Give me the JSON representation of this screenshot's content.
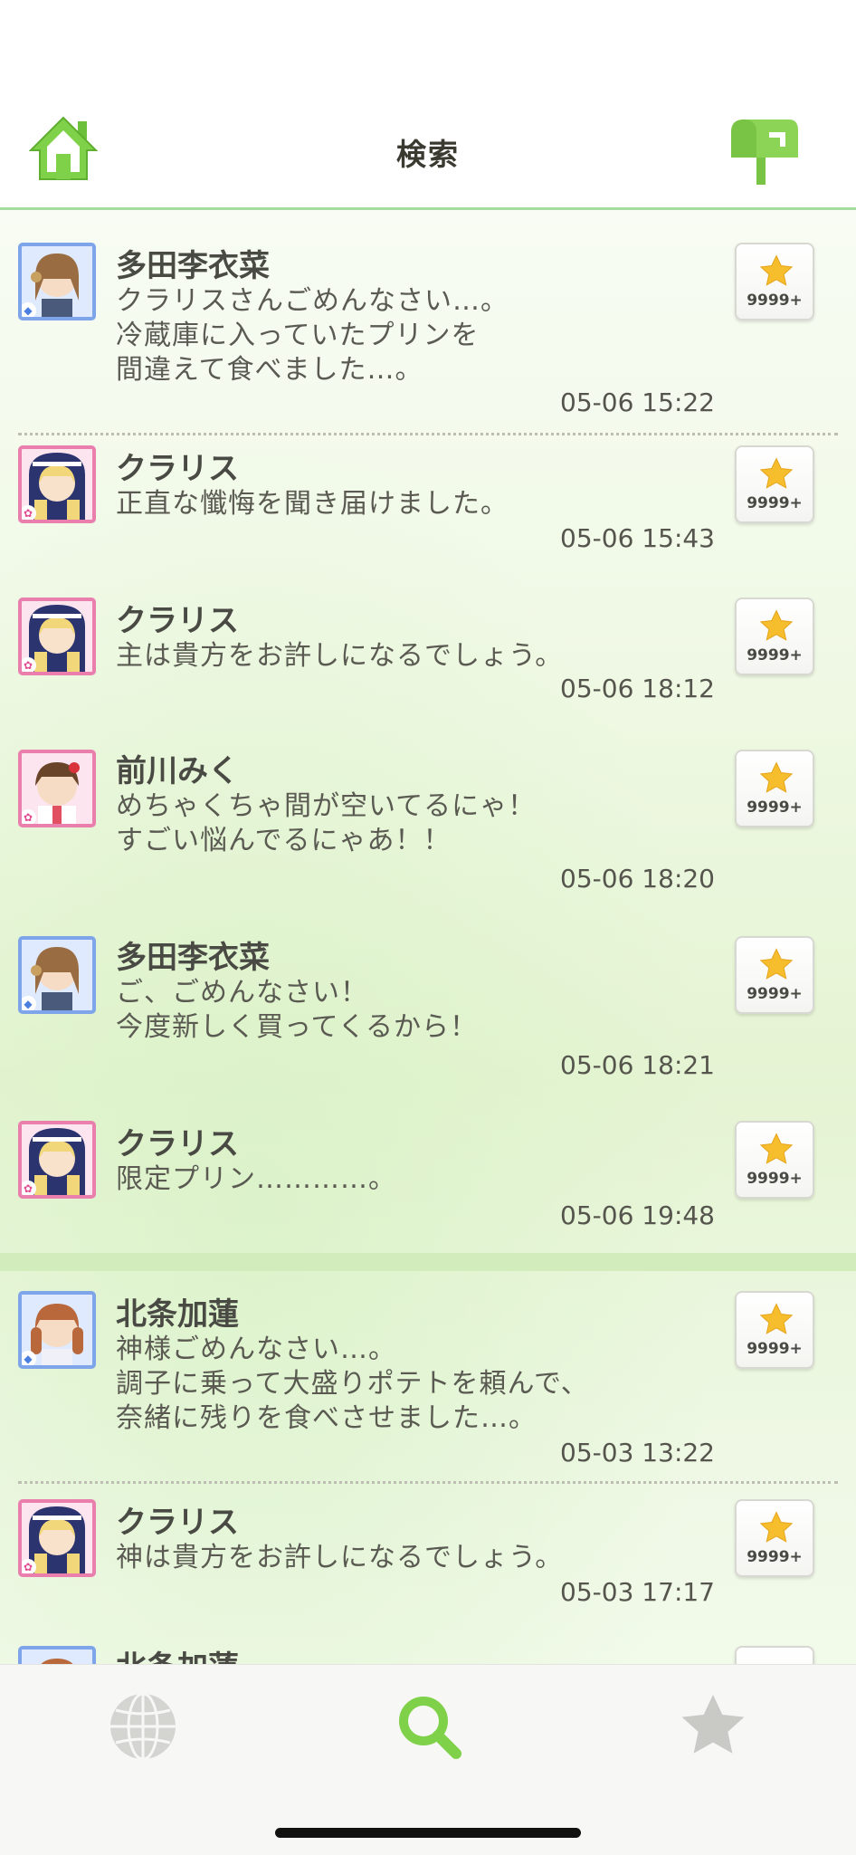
{
  "header": {
    "title": "検索",
    "home_icon": "home-icon",
    "mail_icon": "mailbox-icon",
    "accent_color": "#7fd14a"
  },
  "posts": [
    {
      "name": "多田李衣菜",
      "message": "クラリスさんごめんなさい…。\n冷蔵庫に入っていたプリンを\n間違えて食べました…。",
      "time": "05-06 15:22",
      "likes": "9999+",
      "frame": "blue"
    },
    {
      "name": "クラリス",
      "message": "正直な懺悔を聞き届けました。",
      "time": "05-06 15:43",
      "likes": "9999+",
      "frame": "pink"
    },
    {
      "name": "クラリス",
      "message": "主は貴方をお許しになるでしょう。",
      "time": "05-06 18:12",
      "likes": "9999+",
      "frame": "pink"
    },
    {
      "name": "前川みく",
      "message": "めちゃくちゃ間が空いてるにゃ！\nすごい悩んでるにゃあ！！",
      "time": "05-06 18:20",
      "likes": "9999+",
      "frame": "pink"
    },
    {
      "name": "多田李衣菜",
      "message": "ご、ごめんなさい！\n今度新しく買ってくるから！",
      "time": "05-06 18:21",
      "likes": "9999+",
      "frame": "blue"
    },
    {
      "name": "クラリス",
      "message": "限定プリン…………。",
      "time": "05-06 19:48",
      "likes": "9999+",
      "frame": "pink"
    },
    {
      "name": "北条加蓮",
      "message": "神様ごめんなさい…。\n調子に乗って大盛りポテトを頼んで、\n奈緒に残りを食べさせました…。",
      "time": "05-03 13:22",
      "likes": "9999+",
      "frame": "blue"
    },
    {
      "name": "クラリス",
      "message": "神は貴方をお許しになるでしょう。",
      "time": "05-03 17:17",
      "likes": "9999+",
      "frame": "pink"
    },
    {
      "name": "北条加蓮",
      "message": "",
      "time": "",
      "likes": "",
      "frame": "blue"
    }
  ],
  "tabbar": {
    "items": [
      {
        "icon": "globe-icon",
        "active": false
      },
      {
        "icon": "search-icon",
        "active": true
      },
      {
        "icon": "star-icon",
        "active": false
      }
    ],
    "active_color": "#7fd14a",
    "inactive_color": "#c9c9c6"
  }
}
